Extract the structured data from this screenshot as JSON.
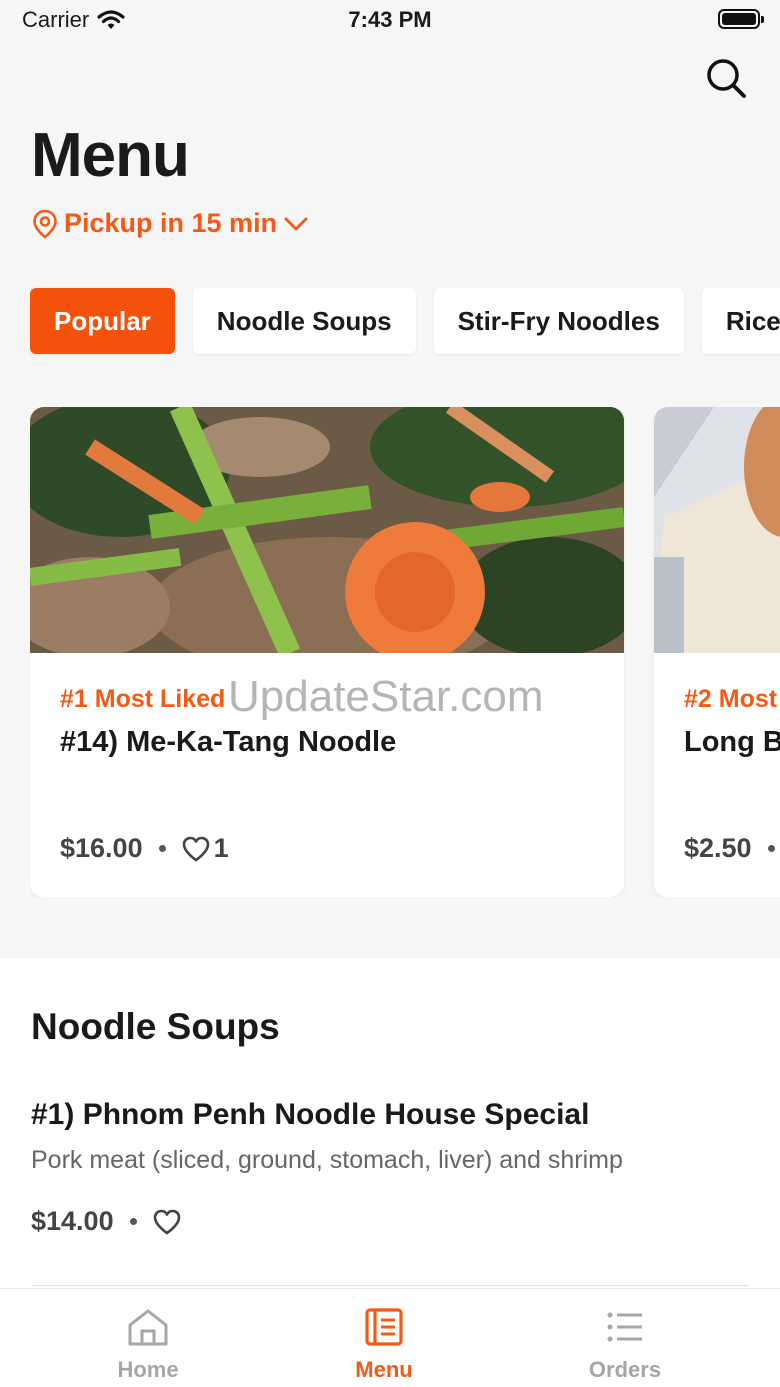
{
  "status_bar": {
    "carrier": "Carrier",
    "time": "7:43 PM"
  },
  "header": {
    "title": "Menu",
    "pickup_label": "Pickup in 15 min"
  },
  "icons": {
    "search": "search-icon",
    "location": "location-pin-icon",
    "chevron": "chevron-down-icon",
    "heart": "heart-icon",
    "home": "home-icon",
    "menu": "menu-book-icon",
    "orders": "list-icon"
  },
  "categories": [
    {
      "label": "Popular",
      "active": true
    },
    {
      "label": "Noodle Soups",
      "active": false
    },
    {
      "label": "Stir-Fry Noodles",
      "active": false
    },
    {
      "label": "Rice",
      "active": false
    }
  ],
  "popular": [
    {
      "tag": "#1 Most Liked",
      "name": "#14) Me-Ka-Tang Noodle",
      "price": "$16.00",
      "likes": "1"
    },
    {
      "tag": "#2 Most",
      "name": "Long B",
      "price": "$2.50"
    }
  ],
  "watermark": "UpdateStar.com",
  "section": {
    "title": "Noodle Soups",
    "item": {
      "name": "#1) Phnom Penh Noodle House Special",
      "description": "Pork meat (sliced, ground, stomach, liver) and shrimp",
      "price": "$14.00"
    }
  },
  "tabbar": {
    "home": "Home",
    "menu": "Menu",
    "orders": "Orders"
  },
  "colors": {
    "accent": "#f4520c",
    "background": "#f6f6f6",
    "inactive_tab": "#a6a6a6"
  }
}
